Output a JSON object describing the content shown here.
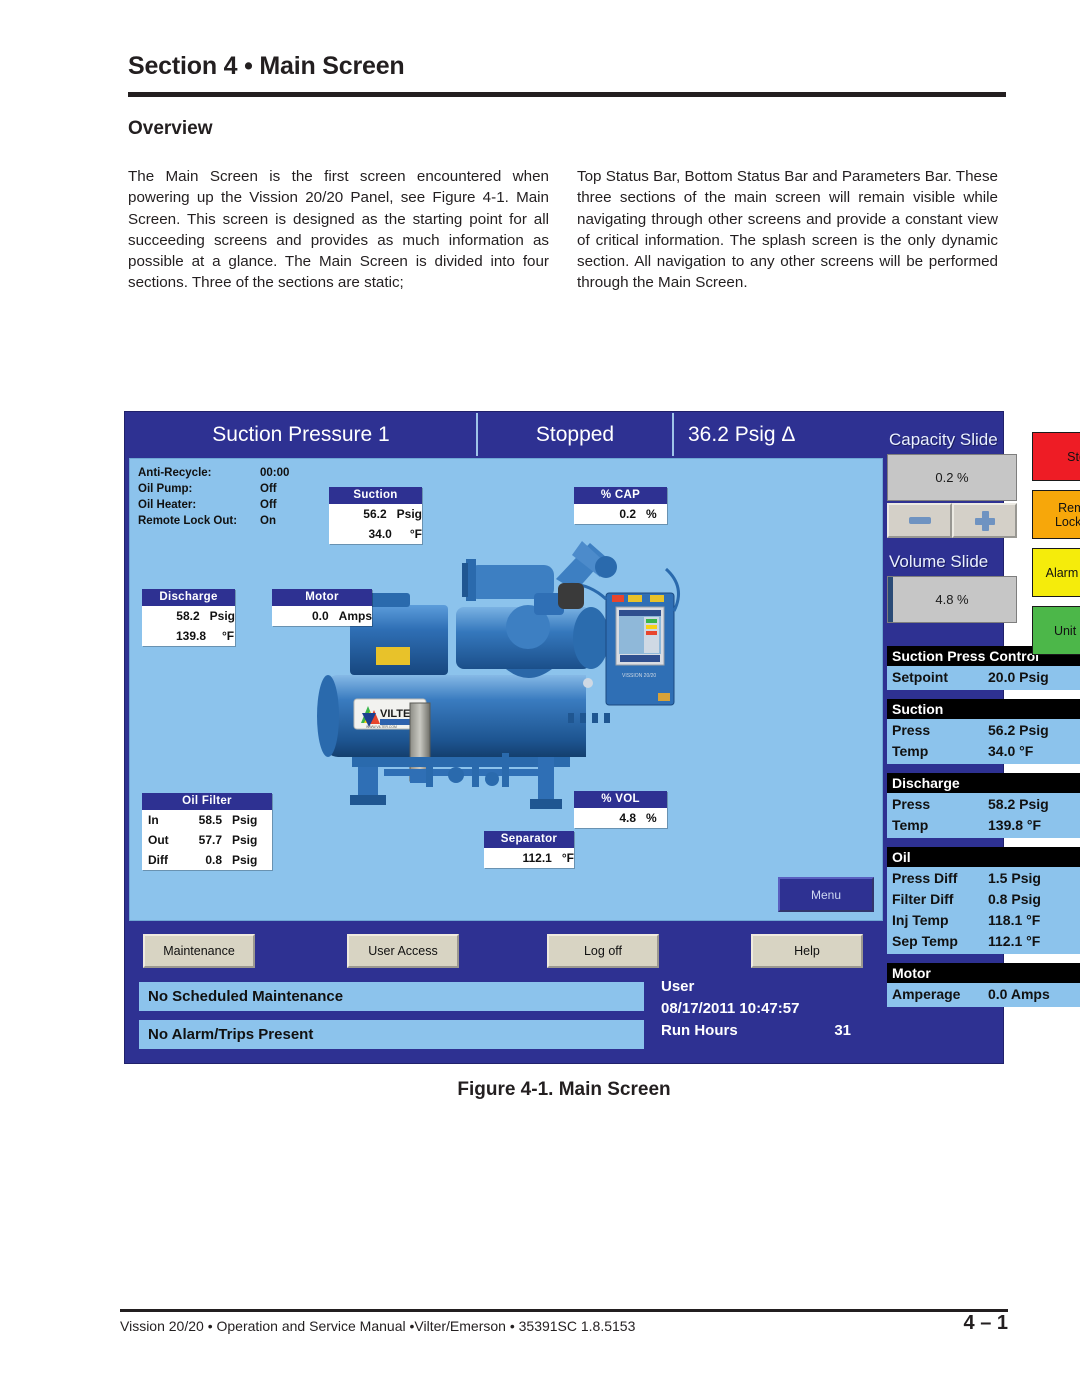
{
  "document": {
    "section_title": "Section 4 • Main Screen",
    "overview_heading": "Overview",
    "body_left": "The Main Screen is the first screen encountered when powering up the Vission 20/20 Panel, see Figure 4-1. Main Screen. This screen is designed as the starting point for all succeeding screens and provides as much information as possible at a glance. The Main Screen is divided into four sections. Three of the sections are static;",
    "body_right": "Top Status Bar, Bottom Status Bar and Parameters Bar. These three sections of the main screen will remain visible while navigating through other screens and provide a constant view of critical information. The splash screen is the only dynamic section. All navigation to any other screens will be performed through the Main Screen.",
    "figure_caption": "Figure 4-1. Main Screen",
    "footer_left": "Vission 20/20 • Operation and Service Manual •Vilter/Emerson • 35391SC 1.8.5153",
    "footer_page": "4  –  1"
  },
  "hmi": {
    "top_bar": {
      "control_mode": "Suction Pressure 1",
      "run_state": "Stopped",
      "delta": "36.2 Psig Δ"
    },
    "status_list": [
      {
        "label": "Anti-Recycle:",
        "value": "00:00"
      },
      {
        "label": "Oil Pump:",
        "value": "Off"
      },
      {
        "label": "Oil Heater:",
        "value": "Off"
      },
      {
        "label": "Remote Lock Out:",
        "value": "On"
      }
    ],
    "readouts": {
      "suction": {
        "title": "Suction",
        "rows": [
          {
            "key": "",
            "num": "56.2",
            "unit": "Psig"
          },
          {
            "key": "",
            "num": "34.0",
            "unit": "°F"
          }
        ]
      },
      "discharge": {
        "title": "Discharge",
        "rows": [
          {
            "key": "",
            "num": "58.2",
            "unit": "Psig"
          },
          {
            "key": "",
            "num": "139.8",
            "unit": "°F"
          }
        ]
      },
      "motor": {
        "title": "Motor",
        "rows": [
          {
            "key": "",
            "num": "0.0",
            "unit": "Amps"
          }
        ]
      },
      "pct_cap": {
        "title": "% CAP",
        "rows": [
          {
            "key": "",
            "num": "0.2",
            "unit": "%"
          }
        ]
      },
      "pct_vol": {
        "title": "% VOL",
        "rows": [
          {
            "key": "",
            "num": "4.8",
            "unit": "%"
          }
        ]
      },
      "separator": {
        "title": "Separator",
        "rows": [
          {
            "key": "",
            "num": "112.1",
            "unit": "°F"
          }
        ]
      },
      "oil_filter": {
        "title": "Oil Filter",
        "rows": [
          {
            "key": "In",
            "num": "58.5",
            "unit": "Psig"
          },
          {
            "key": "Out",
            "num": "57.7",
            "unit": "Psig"
          },
          {
            "key": "Diff",
            "num": "0.8",
            "unit": "Psig"
          }
        ]
      }
    },
    "menu_button": "Menu",
    "slides": {
      "capacity_label": "Capacity Slide",
      "capacity_value": "0.2 %",
      "capacity_pct": 0.2,
      "volume_label": "Volume Slide",
      "volume_value": "4.8 %",
      "volume_pct": 4.8,
      "decrease_icon": "minus-icon",
      "increase_icon": "plus-icon"
    },
    "action_buttons": [
      {
        "label": "Stop",
        "color": "#ee1c25"
      },
      {
        "label": "Remote\nLock Out",
        "color": "#f7a70a"
      },
      {
        "label": "Alarm Reset",
        "color": "#f5ec0b"
      },
      {
        "label": "Unit Start",
        "color": "#4cb749"
      }
    ],
    "parameters": [
      {
        "header": "Suction Press Control",
        "rows": [
          {
            "key": "Setpoint",
            "value": "20.0 Psig"
          }
        ]
      },
      {
        "header": "Suction",
        "rows": [
          {
            "key": "Press",
            "value": "56.2 Psig"
          },
          {
            "key": "Temp",
            "value": "34.0 °F"
          }
        ]
      },
      {
        "header": "Discharge",
        "rows": [
          {
            "key": "Press",
            "value": "58.2 Psig"
          },
          {
            "key": "Temp",
            "value": "139.8 °F"
          }
        ]
      },
      {
        "header": "Oil",
        "rows": [
          {
            "key": "Press Diff",
            "value": "1.5 Psig"
          },
          {
            "key": "Filter Diff",
            "value": "0.8 Psig"
          },
          {
            "key": "Inj Temp",
            "value": "118.1 °F"
          },
          {
            "key": "Sep Temp",
            "value": "112.1 °F"
          }
        ]
      },
      {
        "header": "Motor",
        "rows": [
          {
            "key": "Amperage",
            "value": "0.0 Amps"
          }
        ]
      }
    ],
    "nav_buttons": [
      "Maintenance",
      "User Access",
      "Log off",
      "Help"
    ],
    "messages": [
      "No Scheduled Maintenance",
      "No Alarm/Trips Present"
    ],
    "user_block": {
      "user_label": "User",
      "datetime": "08/17/2011  10:47:57",
      "run_hours_label": "Run Hours",
      "run_hours_value": "31"
    },
    "machine_logo": "VILTER"
  }
}
